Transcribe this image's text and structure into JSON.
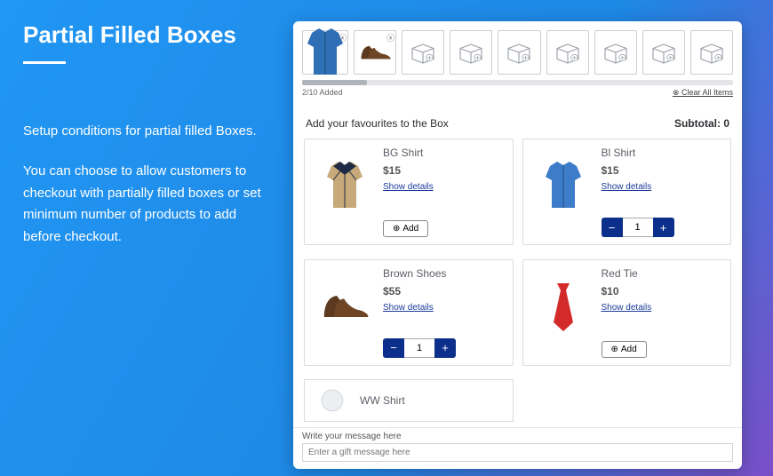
{
  "page": {
    "title": "Partial Filled Boxes",
    "para1": "Setup conditions for partial filled Boxes.",
    "para2": "You can choose to allow customers to checkout with partially filled boxes or set minimum number of products to add before checkout."
  },
  "box": {
    "progress_text": "2/10 Added",
    "clear_label": "Clear All Items",
    "section_title": "Add your favourites to the Box",
    "subtotal_label": "Subtotal:",
    "subtotal_value": "0"
  },
  "products": [
    {
      "name": "BG Shirt",
      "price": "$15",
      "details": "Show details",
      "action": "add",
      "add_label": "Add"
    },
    {
      "name": "Bl Shirt",
      "price": "$15",
      "details": "Show details",
      "action": "qty",
      "qty": "1"
    },
    {
      "name": "Brown Shoes",
      "price": "$55",
      "details": "Show details",
      "action": "qty",
      "qty": "1"
    },
    {
      "name": "Red Tie",
      "price": "$10",
      "details": "Show details",
      "action": "add",
      "add_label": "Add"
    },
    {
      "name": "WW Shirt",
      "price": "",
      "details": "",
      "action": "none"
    }
  ],
  "message": {
    "label": "Write your message here",
    "placeholder": "Enter a gift message here"
  }
}
